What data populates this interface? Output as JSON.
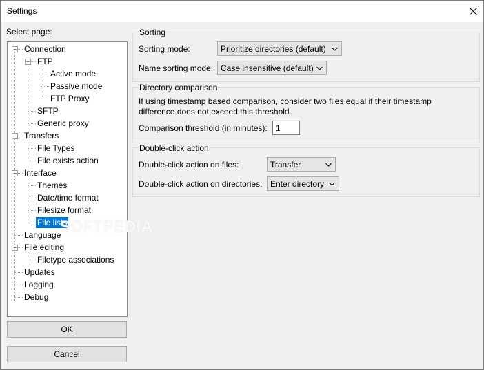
{
  "window": {
    "title": "Settings"
  },
  "sidebar": {
    "label": "Select page:",
    "tree": [
      "Connection",
      "FTP",
      "Active mode",
      "Passive mode",
      "FTP Proxy",
      "SFTP",
      "Generic proxy",
      "Transfers",
      "File Types",
      "File exists action",
      "Interface",
      "Themes",
      "Date/time format",
      "Filesize format",
      "File lists",
      "Language",
      "File editing",
      "Filetype associations",
      "Updates",
      "Logging",
      "Debug"
    ],
    "selected": "File lists"
  },
  "buttons": {
    "ok": "OK",
    "cancel": "Cancel"
  },
  "sorting": {
    "title": "Sorting",
    "mode_label": "Sorting mode:",
    "mode_value": "Prioritize directories (default)",
    "name_label": "Name sorting mode:",
    "name_value": "Case insensitive (default)"
  },
  "directory_comparison": {
    "title": "Directory comparison",
    "desc_line1": "If using timestamp based comparison, consider two files equal if their timestamp",
    "desc_line2": "difference does not exceed this threshold.",
    "threshold_label": "Comparison threshold (in minutes):",
    "threshold_value": "1"
  },
  "double_click": {
    "title": "Double-click action",
    "files_label": "Double-click action on files:",
    "files_value": "Transfer",
    "dirs_label": "Double-click action on directories:",
    "dirs_value": "Enter directory"
  },
  "watermark": "SOFTPEDIA",
  "icons": {
    "close": "close-icon",
    "expand": "collapse-icon",
    "dropdown": "chevron-down-icon"
  }
}
